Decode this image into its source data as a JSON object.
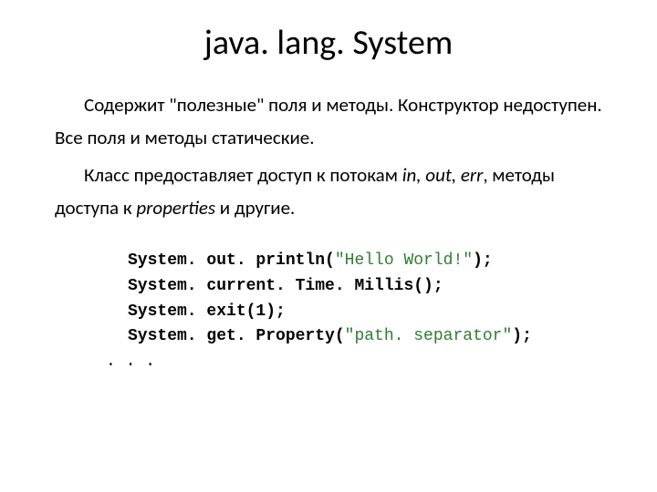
{
  "title": "java. lang. System",
  "para1_a": "Содержит \"полезные\" поля и методы. Конструктор недоступен. Все поля и методы статические.",
  "para2_a": "Класс предоставляет доступ к потокам ",
  "para2_b": "in, out, err",
  "para2_c": ", методы доступа к ",
  "para2_d": "properties",
  "para2_e": " и другие.",
  "code": {
    "l1a": "System. out. println(",
    "l1b": "\"Hello World!\"",
    "l1c": ");",
    "l2": "System. current. Time. Millis();",
    "l3": "System. exit(1);",
    "l4a": "System. get. Property(",
    "l4b": "\"path. separator\"",
    "l4c": ");",
    "l5": ". . ."
  }
}
